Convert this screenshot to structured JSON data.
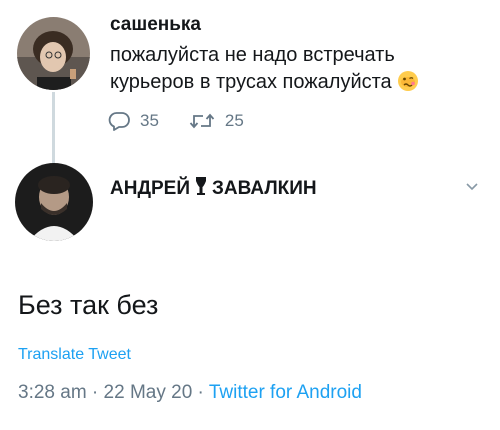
{
  "tweet1": {
    "author": "сашенька",
    "text": "пожалуйста не надо встречать курьеров в трусах пожалуйста",
    "emoji": "woozy-face",
    "replies": "35",
    "retweets": "25"
  },
  "tweet2": {
    "author_part1": "АНДРЕЙ",
    "author_part2": "ЗАВАЛКИН",
    "text": "Без так без",
    "translate_label": "Translate Tweet",
    "time": "3:28 am",
    "date": "22 May 20",
    "source": "Twitter for Android",
    "separator": " · "
  },
  "colors": {
    "text": "#14171a",
    "muted": "#657786",
    "link": "#1da1f2",
    "thread_line": "#cfd9de"
  },
  "icons": [
    "reply-icon",
    "retweet-icon",
    "chevron-down-icon",
    "woozy-face-emoji"
  ]
}
